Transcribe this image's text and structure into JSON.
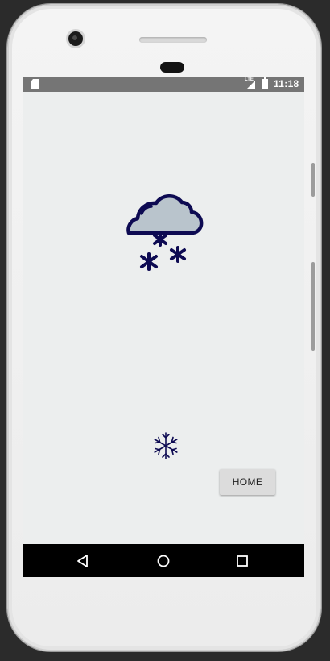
{
  "status_bar": {
    "network": "LTE",
    "time": "11:18"
  },
  "main": {
    "weather_icon": "snow-cloud-icon",
    "secondary_icon": "snowflake-icon",
    "home_button_label": "HOME"
  },
  "nav_bar": {
    "icons": [
      "back-icon",
      "home-icon",
      "recents-icon"
    ]
  },
  "colors": {
    "icon_stroke": "#0d0a52",
    "cloud_fill": "#b9c4cc",
    "screen_bg": "#eceeee",
    "status_bar_bg": "#757575",
    "button_bg": "#dcdcdc"
  }
}
